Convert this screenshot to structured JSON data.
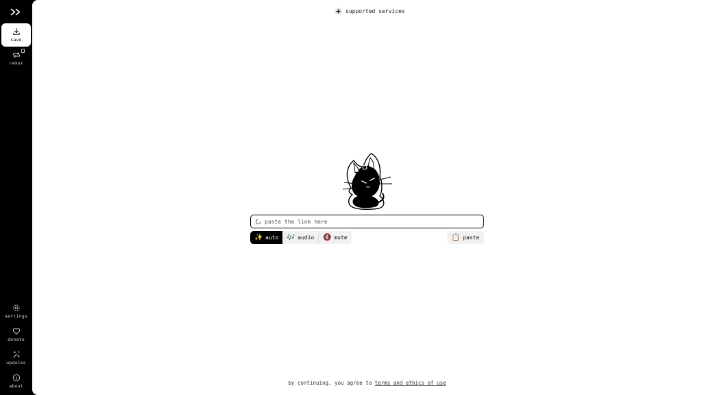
{
  "sidebar": {
    "logo": "double-chevron-right-icon",
    "top_items": [
      {
        "label": "save",
        "icon": "download-icon",
        "active": true
      },
      {
        "label": "remux",
        "icon": "repeat-icon",
        "active": false
      }
    ],
    "bottom_items": [
      {
        "label": "settings",
        "icon": "gear-icon"
      },
      {
        "label": "donate",
        "icon": "heart-icon"
      },
      {
        "label": "updates",
        "icon": "sparkle-icon"
      },
      {
        "label": "about",
        "icon": "info-icon"
      }
    ]
  },
  "header": {
    "services_label": "supported services"
  },
  "omnibox": {
    "placeholder": "paste the link here",
    "value": ""
  },
  "modes": [
    {
      "label": "auto",
      "emoji": "✨",
      "active": true
    },
    {
      "label": "audio",
      "emoji": "🎶",
      "active": false
    },
    {
      "label": "mute",
      "emoji": "🔇",
      "active": false
    }
  ],
  "paste": {
    "label": "paste",
    "emoji": "📋"
  },
  "footer": {
    "prefix": "by continuing, you agree to",
    "link": "terms and ethics of use"
  },
  "colors": {
    "sidebar_bg": "#000000",
    "main_bg": "#ffffff",
    "active_mode_bg": "#000000",
    "button_bg": "#f1f1f1"
  }
}
